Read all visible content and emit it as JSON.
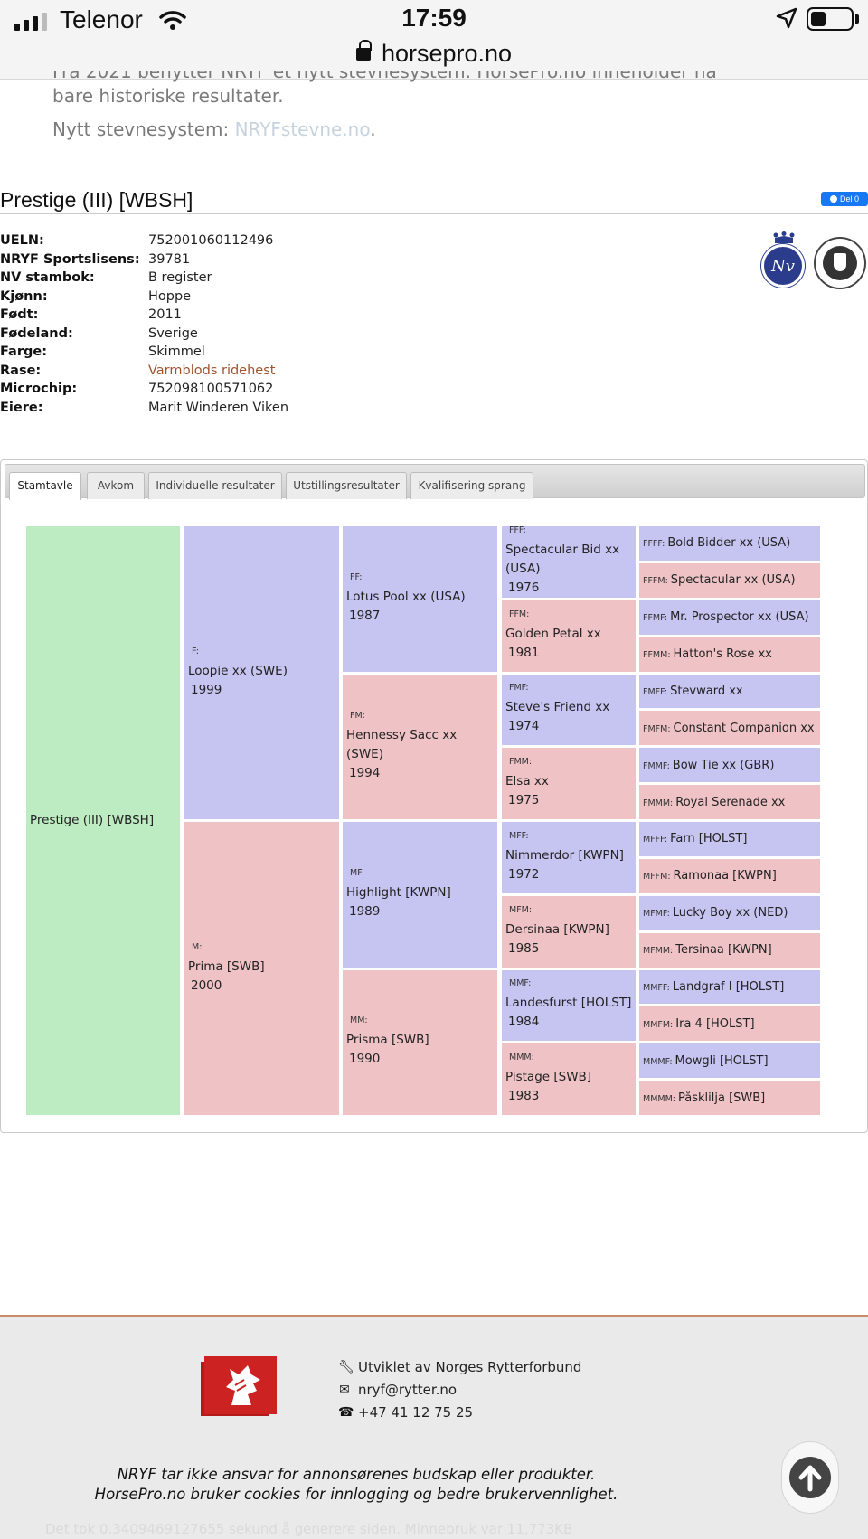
{
  "statusbar": {
    "carrier": "Telenor",
    "time": "17:59",
    "url": "horsepro.no",
    "icons": [
      "signal-icon",
      "wifi-icon",
      "location-icon",
      "battery-icon",
      "lock-icon"
    ]
  },
  "notice": {
    "line1": "Fra 2021 benytter NRYF et nytt stevnesystem. HorsePro.no inneholder nå",
    "line2": "bare historiske resultater.",
    "system_label": "Nytt stevnesystem: ",
    "system_link": "NRYFstevne.no",
    "system_end": "."
  },
  "horse": {
    "title": "Prestige (III) [WBSH]",
    "share_label": "Del 0",
    "fields": [
      {
        "key": "UELN:",
        "value": "752001060112496"
      },
      {
        "key": "NRYF Sportslisens:",
        "value": "39781"
      },
      {
        "key": "NV stambok:",
        "value": "B register"
      },
      {
        "key": "Kjønn:",
        "value": "Hoppe"
      },
      {
        "key": "Født:",
        "value": "2011"
      },
      {
        "key": "Fødeland:",
        "value": "Sverige"
      },
      {
        "key": "Farge:",
        "value": "Skimmel"
      },
      {
        "key": "Rase:",
        "value": "Varmblods ridehest"
      },
      {
        "key": "Microchip:",
        "value": "752098100571062"
      },
      {
        "key": "Eiere:",
        "value": "Marit Winderen Viken"
      }
    ]
  },
  "tabs": [
    {
      "label": "Stamtavle",
      "active": true
    },
    {
      "label": "Avkom",
      "active": false
    },
    {
      "label": "Individuelle resultater",
      "active": false
    },
    {
      "label": "Utstillingsresultater",
      "active": false
    },
    {
      "label": "Kvalifisering sprang",
      "active": false
    }
  ],
  "pedigree": {
    "root": {
      "code": "",
      "name": "Prestige (III) [WBSH]",
      "year": ""
    },
    "gen2": [
      {
        "code": "F:",
        "name": "Loopie xx (SWE)",
        "year": "1999"
      },
      {
        "code": "M:",
        "name": "Prima [SWB]",
        "year": "2000"
      }
    ],
    "gen3": [
      {
        "code": "FF:",
        "name": "Lotus Pool xx (USA)",
        "year": "1987"
      },
      {
        "code": "FM:",
        "name": "Hennessy Sacc xx (SWE)",
        "year": "1994"
      },
      {
        "code": "MF:",
        "name": "Highlight [KWPN]",
        "year": "1989"
      },
      {
        "code": "MM:",
        "name": "Prisma [SWB]",
        "year": "1990"
      }
    ],
    "gen4": [
      {
        "code": "FFF:",
        "name": "Spectacular Bid xx (USA)",
        "year": "1976"
      },
      {
        "code": "FFM:",
        "name": "Golden Petal xx",
        "year": "1981"
      },
      {
        "code": "FMF:",
        "name": "Steve's Friend xx",
        "year": "1974"
      },
      {
        "code": "FMM:",
        "name": "Elsa xx",
        "year": "1975"
      },
      {
        "code": "MFF:",
        "name": "Nimmerdor [KWPN]",
        "year": "1972"
      },
      {
        "code": "MFM:",
        "name": "Dersinaa [KWPN]",
        "year": "1985"
      },
      {
        "code": "MMF:",
        "name": "Landesfurst [HOLST]",
        "year": "1984"
      },
      {
        "code": "MMM:",
        "name": "Pistage [SWB]",
        "year": "1983"
      }
    ],
    "gen5": [
      {
        "code": "FFFF:",
        "name": "Bold Bidder xx (USA)"
      },
      {
        "code": "FFFM:",
        "name": "Spectacular xx (USA)"
      },
      {
        "code": "FFMF:",
        "name": "Mr. Prospector xx (USA)"
      },
      {
        "code": "FFMM:",
        "name": "Hatton's Rose xx"
      },
      {
        "code": "FMFF:",
        "name": "Stevward xx"
      },
      {
        "code": "FMFM:",
        "name": "Constant Companion xx"
      },
      {
        "code": "FMMF:",
        "name": "Bow Tie xx (GBR)"
      },
      {
        "code": "FMMM:",
        "name": "Royal Serenade xx"
      },
      {
        "code": "MFFF:",
        "name": "Farn [HOLST]"
      },
      {
        "code": "MFFM:",
        "name": "Ramonaa [KWPN]"
      },
      {
        "code": "MFMF:",
        "name": "Lucky Boy xx (NED)"
      },
      {
        "code": "MFMM:",
        "name": "Tersinaa [KWPN]"
      },
      {
        "code": "MMFF:",
        "name": "Landgraf I [HOLST]"
      },
      {
        "code": "MMFM:",
        "name": "Ira 4 [HOLST]"
      },
      {
        "code": "MMMF:",
        "name": "Mowgli [HOLST]"
      },
      {
        "code": "MMMM:",
        "name": "Påsklilja [SWB]"
      }
    ],
    "colors": {
      "root": "#bdebc2",
      "sire": "#c6c4f1",
      "dam": "#efc3c6"
    }
  },
  "footer": {
    "developed": "Utviklet av Norges Rytterforbund",
    "email": "nryf@rytter.no",
    "phone": "+47 41 12 75 25",
    "disclaimer1": "NRYF tar ikke ansvar for annonsørenes budskap eller produkter.",
    "disclaimer2": "HorsePro.no bruker cookies for innlogging og bedre brukervennlighet.",
    "gen_note": "Det tok 0.3409469127655 sekund å generere siden. Minnebruk var 11,773KB",
    "accent": "#cc2222"
  }
}
